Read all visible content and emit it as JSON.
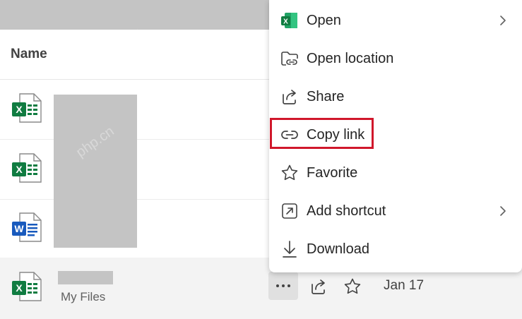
{
  "list": {
    "column_name": "Name",
    "rows": [
      {
        "type": "excel",
        "location": ""
      },
      {
        "type": "excel",
        "location": ""
      },
      {
        "type": "word",
        "location": ""
      },
      {
        "type": "excel",
        "location": "My Files"
      }
    ],
    "selected_row": {
      "date": "Jan 17"
    }
  },
  "context_menu": {
    "items": [
      {
        "label": "Open",
        "icon": "excel-icon",
        "submenu": true
      },
      {
        "label": "Open location",
        "icon": "folder-link-icon",
        "submenu": false
      },
      {
        "label": "Share",
        "icon": "share-icon",
        "submenu": false
      },
      {
        "label": "Copy link",
        "icon": "link-icon",
        "submenu": false,
        "highlighted": true
      },
      {
        "label": "Favorite",
        "icon": "star-icon",
        "submenu": false
      },
      {
        "label": "Add shortcut",
        "icon": "shortcut-icon",
        "submenu": true
      },
      {
        "label": "Download",
        "icon": "download-icon",
        "submenu": false
      }
    ]
  },
  "colors": {
    "excel_green": "#107c41",
    "word_blue": "#185abd",
    "highlight_red": "#d0172b",
    "redaction_gray": "#c4c4c4"
  },
  "watermark": "php.cn"
}
